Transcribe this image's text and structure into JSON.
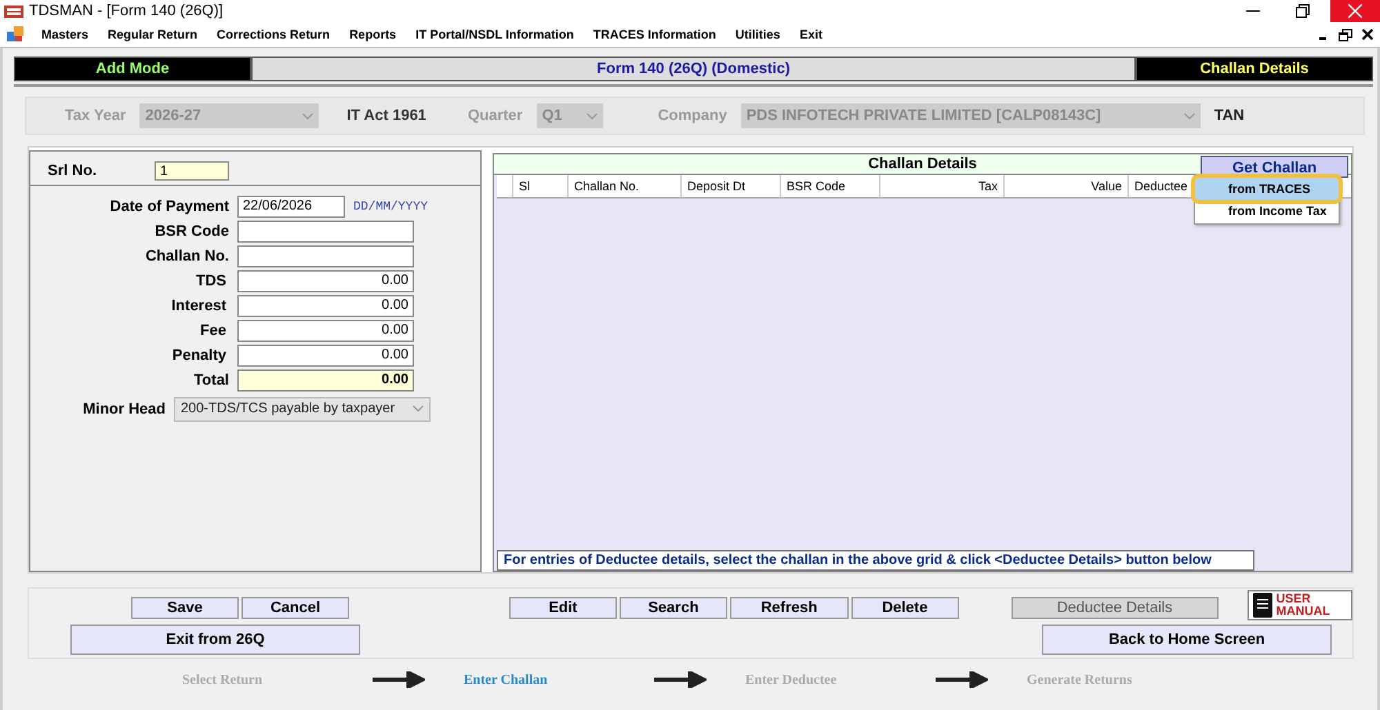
{
  "window": {
    "title": "TDSMAN - [Form 140 (26Q)]"
  },
  "menu": {
    "items": [
      {
        "label": "Masters"
      },
      {
        "label": "Regular Return"
      },
      {
        "label": "Corrections Return"
      },
      {
        "label": "Reports"
      },
      {
        "label": "IT Portal/NSDL Information"
      },
      {
        "label": "TRACES Information"
      },
      {
        "label": "Utilities"
      },
      {
        "label": "Exit"
      }
    ]
  },
  "mode_bar": {
    "mode": "Add Mode",
    "form": "Form 140 (26Q) (Domestic)",
    "section": "Challan Details"
  },
  "filters": {
    "tax_year": {
      "label": "Tax Year",
      "value": "2026-27",
      "disabled": true
    },
    "act": "IT Act 1961",
    "quarter": {
      "label": "Quarter",
      "value": "Q1",
      "disabled": true
    },
    "company": {
      "label": "Company",
      "value": "PDS INFOTECH PRIVATE LIMITED [CALP08143C]",
      "disabled": true
    },
    "tan_label": "TAN"
  },
  "challan_form": {
    "srl": {
      "label": "Srl No.",
      "value": "1"
    },
    "fields": [
      {
        "kind": "date",
        "label": "Date of Payment",
        "value": "22/06/2026",
        "hint": "DD/MM/YYYY"
      },
      {
        "kind": "text",
        "label": "BSR Code"
      },
      {
        "kind": "text",
        "label": "Challan No."
      },
      {
        "kind": "amount",
        "label": "TDS",
        "value": "0.00"
      },
      {
        "kind": "amount",
        "label": "Interest",
        "value": "0.00"
      },
      {
        "kind": "amount",
        "label": "Fee",
        "value": "0.00"
      },
      {
        "kind": "amount",
        "label": "Penalty",
        "value": "0.00"
      },
      {
        "kind": "total",
        "label": "Total",
        "value": "0.00"
      }
    ],
    "minor_head": {
      "label": "Minor Head",
      "value": "200-TDS/TCS payable by taxpayer"
    }
  },
  "challan_grid": {
    "title": "Challan Details",
    "get_challan": "Get Challan",
    "get_challan_menu": [
      {
        "label": "from TRACES",
        "selected": true
      },
      {
        "label": "from Income Tax",
        "selected": false
      }
    ],
    "columns": [
      {
        "label": "Sl"
      },
      {
        "label": "Challan No."
      },
      {
        "label": "Deposit Dt"
      },
      {
        "label": "BSR Code"
      },
      {
        "label": "Tax"
      },
      {
        "label": "Value"
      },
      {
        "label": "Deductee"
      }
    ],
    "note": "For entries of Deductee details, select the challan in the above grid & click <Deductee Details> button below"
  },
  "actions": {
    "row_1": [
      {
        "label": "Save",
        "disabled": false
      },
      {
        "label": "Cancel",
        "disabled": false
      },
      {
        "label": "Edit",
        "disabled": false
      },
      {
        "label": "Search",
        "disabled": false
      },
      {
        "label": "Refresh",
        "disabled": false
      },
      {
        "label": "Delete",
        "disabled": false
      },
      {
        "label": "Deductee Details",
        "disabled": true
      }
    ],
    "row_2": [
      {
        "label": "Exit from 26Q",
        "disabled": false
      },
      {
        "label": "Back to Home Screen",
        "disabled": false
      }
    ],
    "user_manual": [
      "USER",
      "MANUAL"
    ]
  },
  "steps": [
    {
      "label": "Select Return",
      "selected": false
    },
    {
      "label": "Enter Challan",
      "selected": true
    },
    {
      "label": "Enter Deductee",
      "selected": false
    },
    {
      "label": "Generate Returns",
      "selected": false
    }
  ]
}
